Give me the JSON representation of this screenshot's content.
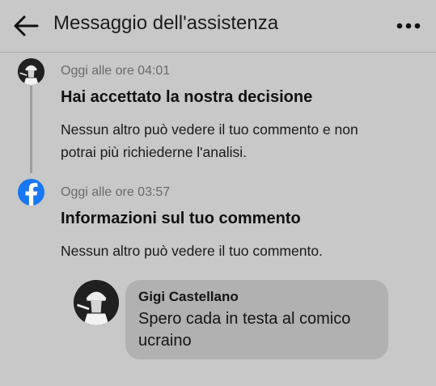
{
  "header": {
    "title": "Messaggio dell'assistenza",
    "back_icon": "arrow-left-icon",
    "more_icon": "more-horizontal-icon"
  },
  "events": [
    {
      "timestamp": "Oggi alle ore 04:01",
      "title": "Hai accettato la nostra decisione",
      "text_lines": [
        "Nessun altro può vedere il tuo commento e non",
        "potrai più richiederne l'analisi."
      ]
    },
    {
      "timestamp": "Oggi alle ore 03:57",
      "title": "Informazioni sul tuo commento",
      "text_lines": [
        "Nessun altro può vedere il tuo commento."
      ]
    }
  ],
  "comment": {
    "author": "Gigi Castellano",
    "text_lines": [
      "Spero cada in testa al comico",
      "ucraino"
    ]
  },
  "colors": {
    "facebook_blue": "#1877F2",
    "background": "#c8c8c8",
    "bubble": "#b1b1b1"
  }
}
